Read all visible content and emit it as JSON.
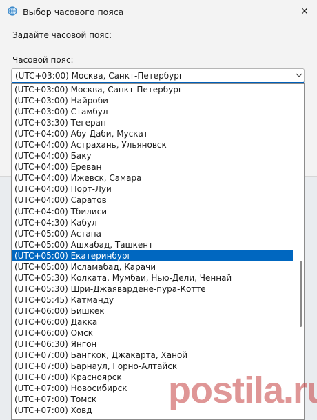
{
  "window": {
    "title": "Выбор часового пояса",
    "close_glyph": "✕"
  },
  "prompt": "Задайте часовой пояс:",
  "timezone_label": "Часовой пояс:",
  "combo": {
    "selected_value": "(UTC+03:00) Москва, Санкт-Петербург"
  },
  "timezones": [
    "(UTC+03:00) Москва, Санкт-Петербург",
    "(UTC+03:00) Найроби",
    "(UTC+03:00) Стамбул",
    "(UTC+03:30) Тегеран",
    "(UTC+04:00) Абу-Даби, Мускат",
    "(UTC+04:00) Астрахань, Ульяновск",
    "(UTC+04:00) Баку",
    "(UTC+04:00) Ереван",
    "(UTC+04:00) Ижевск, Самара",
    "(UTC+04:00) Порт-Луи",
    "(UTC+04:00) Саратов",
    "(UTC+04:00) Тбилиси",
    "(UTC+04:30) Кабул",
    "(UTC+05:00) Астана",
    "(UTC+05:00) Ашхабад, Ташкент",
    "(UTC+05:00) Екатеринбург",
    "(UTC+05:00) Исламабад, Карачи",
    "(UTC+05:30) Колката, Мумбаи, Нью-Дели, Ченнай",
    "(UTC+05:30) Шри-Джаявардене-пура-Котте",
    "(UTC+05:45) Катманду",
    "(UTC+06:00) Бишкек",
    "(UTC+06:00) Дакка",
    "(UTC+06:00) Омск",
    "(UTC+06:30) Янгон",
    "(UTC+07:00) Бангкок, Джакарта, Ханой",
    "(UTC+07:00) Барнаул, Горно-Алтайск",
    "(UTC+07:00) Красноярск",
    "(UTC+07:00) Новосибирск",
    "(UTC+07:00) Томск",
    "(UTC+07:00) Ховд"
  ],
  "highlighted_index": 15,
  "accent_color": "#0067c0",
  "watermark": "postila.ru",
  "icons": {
    "app": "globe-clock-icon",
    "close": "close-icon",
    "chevron": "chevron-down-icon"
  }
}
